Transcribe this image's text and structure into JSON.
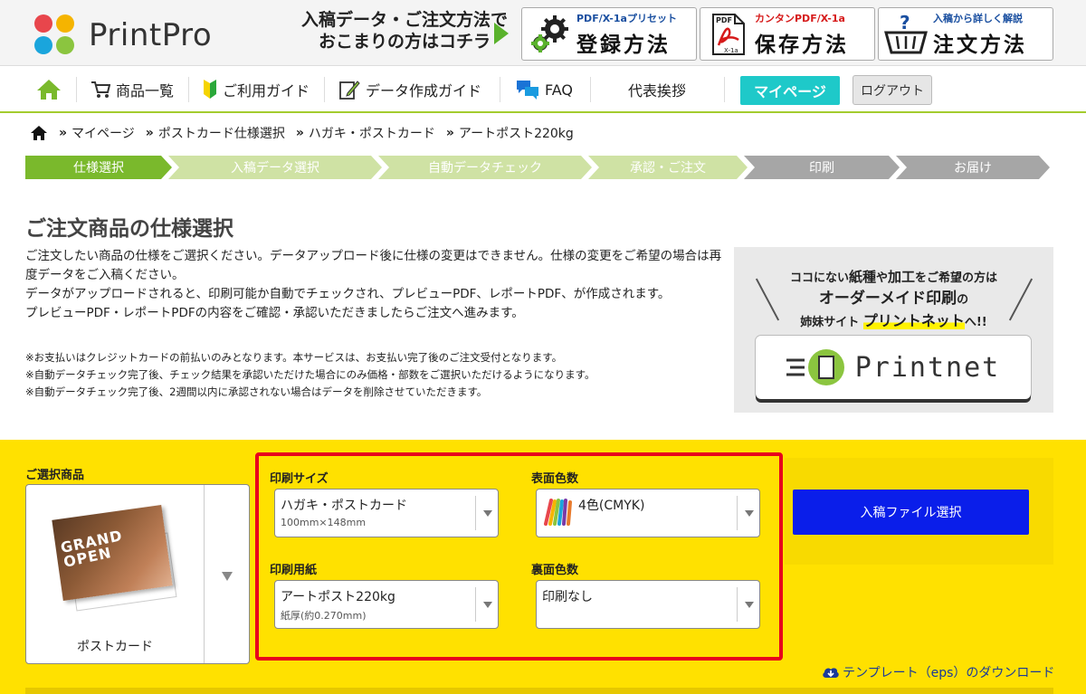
{
  "header": {
    "logo_text": "PrintPro",
    "promo_line1": "入稿データ・ご注文方法で",
    "promo_line2": "おこまりの方はコチラ",
    "buttons": [
      {
        "small": "PDF/X-1aプリセット",
        "big": "登録方法",
        "small_color": "#1a4fa0"
      },
      {
        "small": "カンタンPDF/X-1a",
        "big": "保存方法",
        "small_color": "#d61a1a"
      },
      {
        "small": "入稿から詳しく解説",
        "big": "注文方法",
        "small_color": "#1a4fa0"
      }
    ],
    "pdf_icon_label": "PDF",
    "pdf_icon_sub": "X-1a"
  },
  "nav": {
    "items": [
      "商品一覧",
      "ご利用ガイド",
      "データ作成ガイド",
      "FAQ",
      "代表挨拶"
    ],
    "mypage": "マイページ",
    "logout": "ログアウト"
  },
  "breadcrumb": [
    "マイページ",
    "ポストカード仕様選択",
    "ハガキ・ポストカード",
    "アートポスト220kg"
  ],
  "breadcrumb_sep": "»",
  "steps": [
    {
      "label": "仕様選択",
      "color": "#7ab92c"
    },
    {
      "label": "入稿データ選択",
      "color": "#cfe2a4"
    },
    {
      "label": "自動データチェック",
      "color": "#cfe2a4"
    },
    {
      "label": "承認・ご注文",
      "color": "#cfe2a4"
    },
    {
      "label": "印刷",
      "color": "#a6a6a6"
    },
    {
      "label": "お届け",
      "color": "#a6a6a6"
    }
  ],
  "intro": {
    "title": "ご注文商品の仕様選択",
    "desc1": "ご注文したい商品の仕様をご選択ください。データアップロード後に仕様の変更はできません。仕様の変更をご希望の場合は再度データをご入稿ください。",
    "desc2": "データがアップロードされると、印刷可能か自動でチェックされ、プレビューPDF、レポートPDF、が作成されます。",
    "desc3": "プレビューPDF・レポートPDFの内容をご確認・承認いただきましたらご注文へ進みます。",
    "notes": [
      "※お支払いはクレジットカードの前払いのみとなります。本サービスは、お支払い完了後のご注文受付となります。",
      "※自動データチェック完了後、チェック結果を承認いただけた場合にのみ価格・部数をご選択いただけるようになります。",
      "※自動データチェック完了後、2週間以内に承認されない場合はデータを削除させていただきます。"
    ]
  },
  "banner": {
    "line1_a": "ココにない",
    "line1_b": "紙種",
    "line1_c": "や",
    "line1_d": "加工",
    "line1_e": "をご希望の方は",
    "line2_a": "オーダーメイド印刷",
    "line2_b": "の",
    "line3_a": "姉妹サイト",
    "line3_b": "プリントネット",
    "line3_c": "へ!!",
    "logo": "Printnet"
  },
  "config": {
    "selected_label": "ご選択商品",
    "product_name": "ポストカード",
    "card_text_1": "GRAND",
    "card_text_2": "OPEN",
    "fields": {
      "size": {
        "label": "印刷サイズ",
        "value": "ハガキ・ポストカード",
        "sub": "100mm×148mm"
      },
      "front": {
        "label": "表面色数",
        "value": "4色(CMYK)"
      },
      "paper": {
        "label": "印刷用紙",
        "value": "アートポスト220kg",
        "sub": "紙厚(約0.270mm)"
      },
      "back": {
        "label": "裏面色数",
        "value": "印刷なし"
      }
    },
    "upload_button": "入稿ファイル選択",
    "template_link": "テンプレート（eps）のダウンロード"
  },
  "colors": {
    "accent_green": "#a3cc2e",
    "mypage_teal": "#1ec9c9",
    "config_yellow": "#ffe100",
    "highlight_red": "#e8001c",
    "upload_blue": "#0a1eea"
  }
}
